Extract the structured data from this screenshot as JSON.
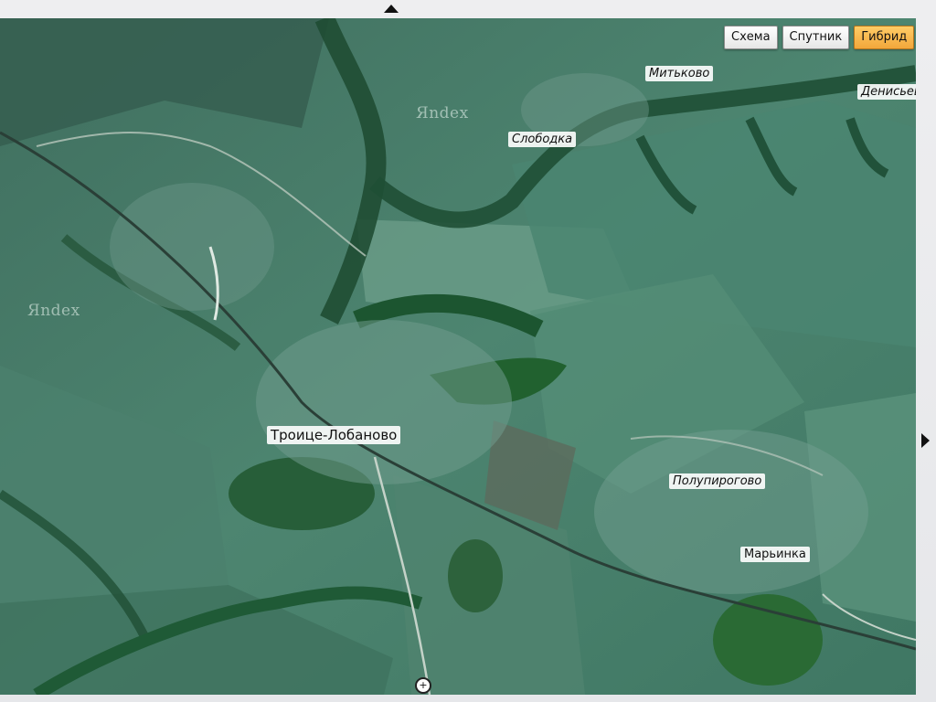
{
  "map_type_switch": {
    "schema_label": "Схема",
    "satellite_label": "Спутник",
    "hybrid_label": "Гибрид",
    "active": "hybrid"
  },
  "places": {
    "mitkovo": "Митьково",
    "denisevo": "Денисьев",
    "slobodka": "Слободка",
    "troitse_lobanovo": "Троице-Лобаново",
    "polupirogovo": "Полупирогово",
    "marinka": "Марьинка"
  },
  "watermarks": {
    "top": "Яndex",
    "left": "Яndex"
  },
  "zoom_cursor_glyph": "+",
  "colors": {
    "fields": "#4f8a73",
    "dark_fields": "#35705c",
    "forest": "#1f5c32",
    "roads": "#b9c8bd",
    "active_button": "#f2a73b"
  }
}
